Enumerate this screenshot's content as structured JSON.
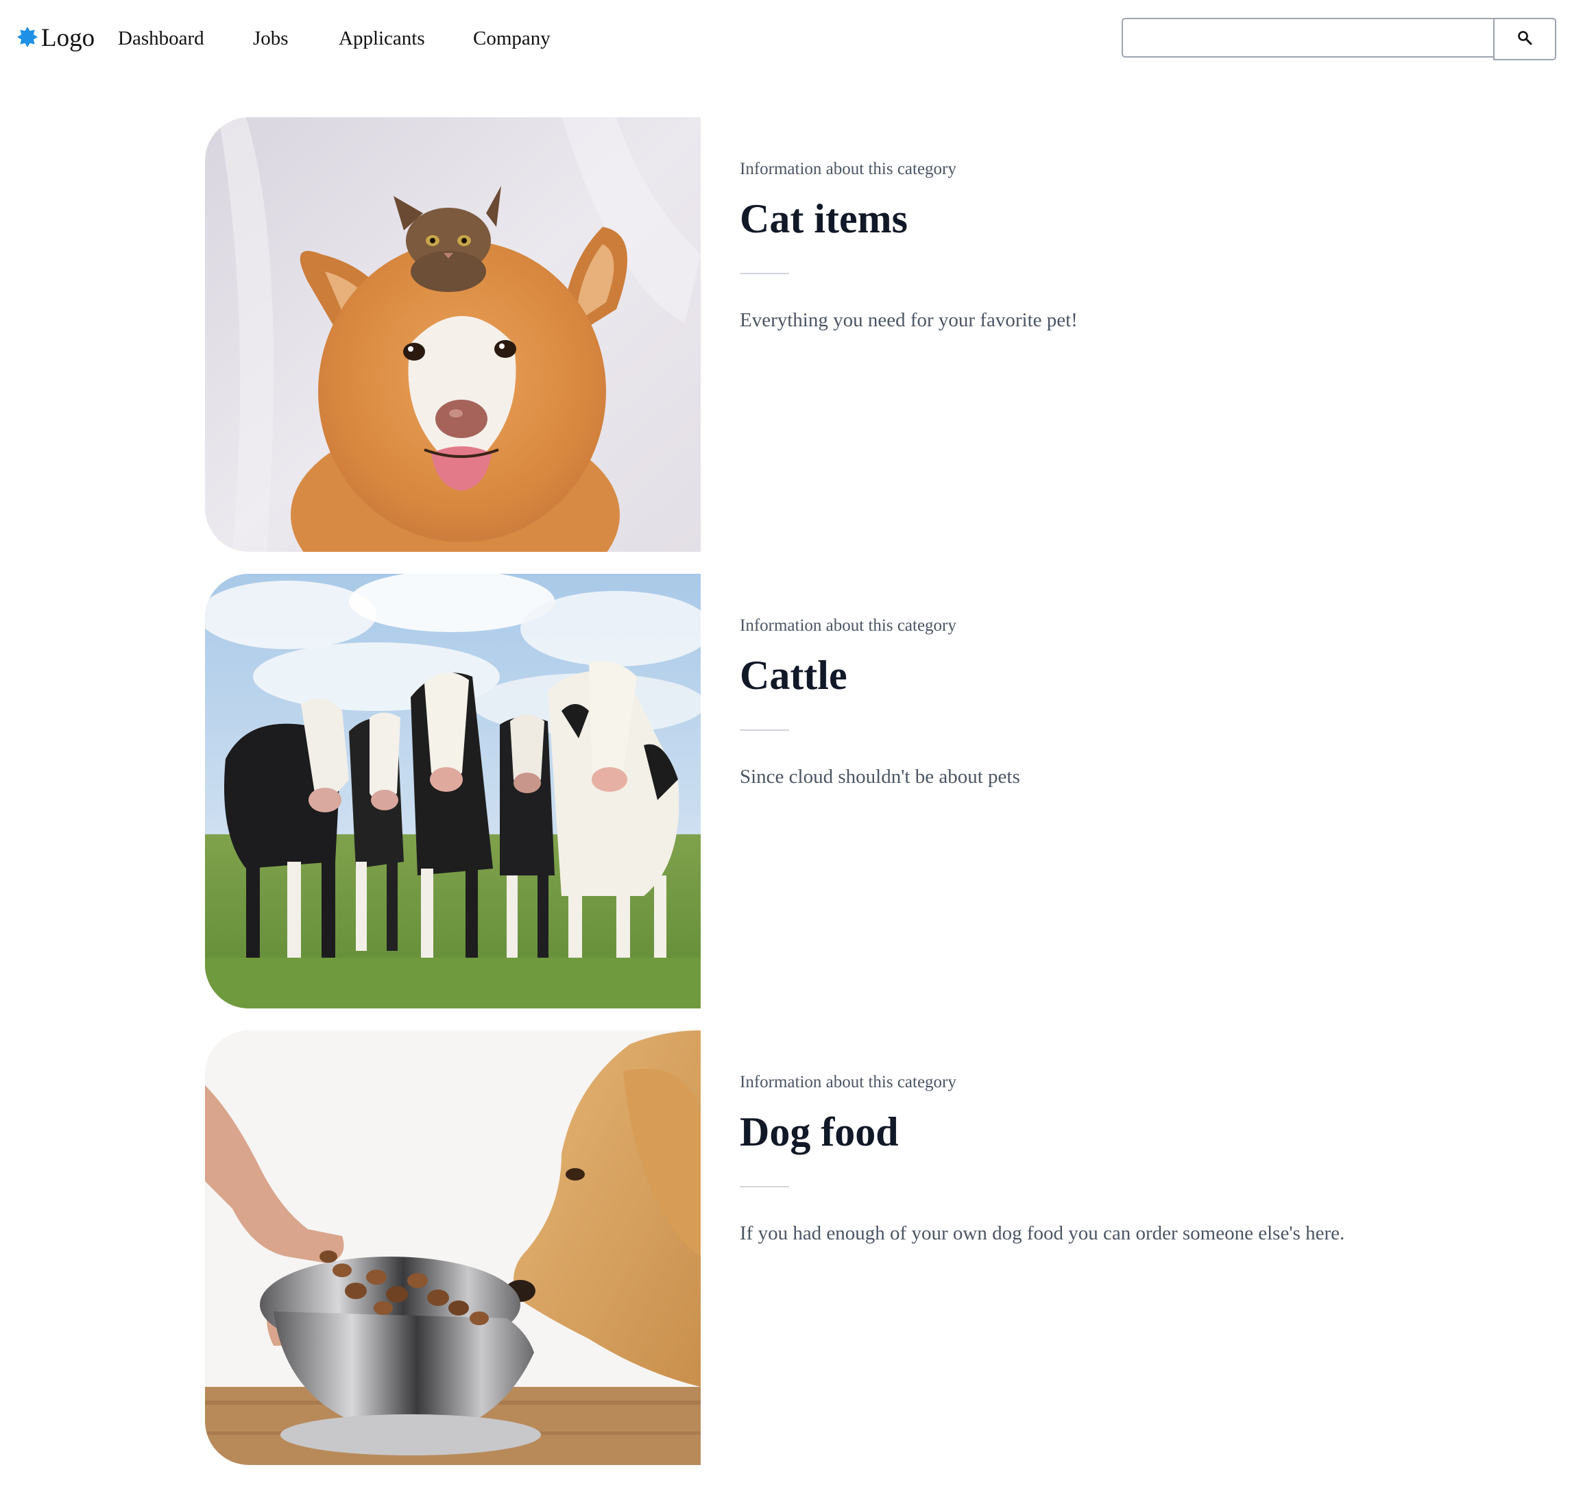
{
  "header": {
    "logo_text": "Logo",
    "logo_color": "#1e90e6",
    "nav": [
      {
        "label": "Dashboard"
      },
      {
        "label": "Jobs"
      },
      {
        "label": "Applicants"
      },
      {
        "label": "Company"
      }
    ],
    "search": {
      "value": "",
      "placeholder": "",
      "button_icon": "search-icon"
    }
  },
  "categories": [
    {
      "eyebrow": "Information about this category",
      "title": "Cat items",
      "description": "Everything you need for your favorite pet!",
      "image": "dog-with-kitten-photo"
    },
    {
      "eyebrow": "Information about this category",
      "title": "Cattle",
      "description": "Since cloud shouldn't be about pets",
      "image": "cows-in-field-photo"
    },
    {
      "eyebrow": "Information about this category",
      "title": "Dog food",
      "description": "If you had enough of your own dog food you can order someone else's here.",
      "image": "dog-food-bowl-photo"
    }
  ],
  "colors": {
    "heading": "#111827",
    "muted_text": "#4b5563",
    "divider": "#d1d5db",
    "input_border": "#9ca3af"
  }
}
